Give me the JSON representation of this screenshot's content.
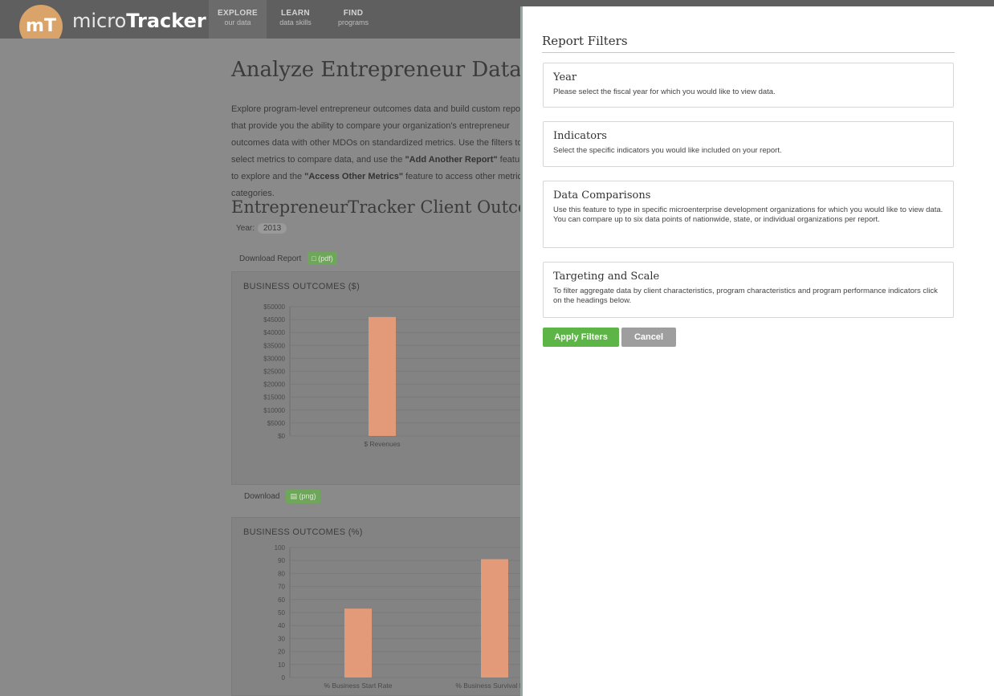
{
  "brand": {
    "badge": "mT",
    "name_prefix": "micro",
    "name_bold": "Tracker"
  },
  "nav": [
    {
      "label": "EXPLORE",
      "sub": "our data"
    },
    {
      "label": "LEARN",
      "sub": "data skills"
    },
    {
      "label": "FIND",
      "sub": "programs"
    }
  ],
  "page": {
    "title": "Analyze Entrepreneur Data",
    "intro_1": "Explore program-level entrepreneur outcomes data and build custom reports that provide you the ability to compare your organization's entrepreneur outcomes data with other MDOs on standardized metrics. Use the filters to select metrics to compare data, and use the ",
    "intro_add": "\"Add Another Report\"",
    "intro_2": " feature to explore and the ",
    "intro_access": "\"Access Other Metrics\"",
    "intro_3": " feature to access other metrics categories.",
    "section_title": "EntrepreneurTracker Client Outcomes",
    "year_label": "Year:",
    "year_value": "2013",
    "download_report": "Download Report",
    "pdf_label": "(pdf)",
    "download": "Download",
    "png_label": "(png)"
  },
  "chart_data": [
    {
      "type": "bar",
      "title": "BUSINESS OUTCOMES ($)",
      "categories": [
        "$ Revenues"
      ],
      "values": [
        46000
      ],
      "ylim": [
        0,
        50000
      ],
      "yticks": [
        "$0",
        "$5000",
        "$10000",
        "$15000",
        "$20000",
        "$25000",
        "$30000",
        "$35000",
        "$40000",
        "$45000",
        "$50000"
      ],
      "bar_color": "#e39a78"
    },
    {
      "type": "bar",
      "title": "BUSINESS OUTCOMES (%)",
      "categories": [
        "% Business Start Rate",
        "% Business Survival Rate"
      ],
      "values": [
        53,
        91
      ],
      "ylim": [
        0,
        100
      ],
      "yticks": [
        "0",
        "10",
        "20",
        "30",
        "40",
        "50",
        "60",
        "70",
        "80",
        "90",
        "100"
      ],
      "bar_color": "#e39a78"
    }
  ],
  "panel": {
    "title": "Report Filters",
    "filters": [
      {
        "title": "Year",
        "desc": "Please select the fiscal year for which you would like to view data."
      },
      {
        "title": "Indicators",
        "desc": "Select the specific indicators you would like included on your report."
      },
      {
        "title": "Data Comparisons",
        "desc": "Use this feature to type in specific microenterprise development organizations for which you would like to view data. You can compare up to six data points of nationwide, state, or individual organizations per report."
      },
      {
        "title": "Targeting and Scale",
        "desc": "To filter aggregate data by client characteristics, program characteristics and program performance indicators click on the headings below."
      }
    ],
    "apply_label": "Apply Filters",
    "cancel_label": "Cancel"
  }
}
